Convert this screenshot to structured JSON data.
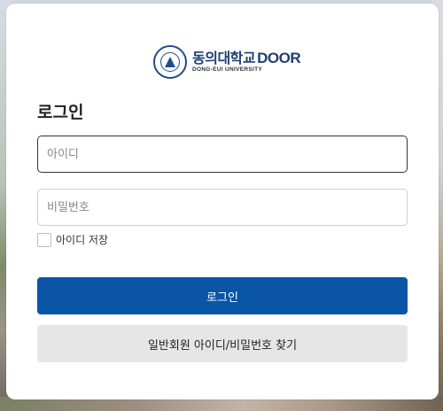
{
  "brand": {
    "name": "동의대학교",
    "product": "DOOR",
    "subtitle": "DONG-EUI UNIVERSITY"
  },
  "login": {
    "title": "로그인",
    "id_placeholder": "아이디",
    "pw_placeholder": "비밀번호",
    "remember_label": "아이디 저장",
    "remember_checked": false,
    "submit_label": "로그인",
    "find_label": "일반회원 아이디/비밀번호 찾기"
  },
  "colors": {
    "primary": "#0a55a6",
    "secondary_button": "#e6e6e6",
    "brand_blue": "#1f3f73"
  }
}
